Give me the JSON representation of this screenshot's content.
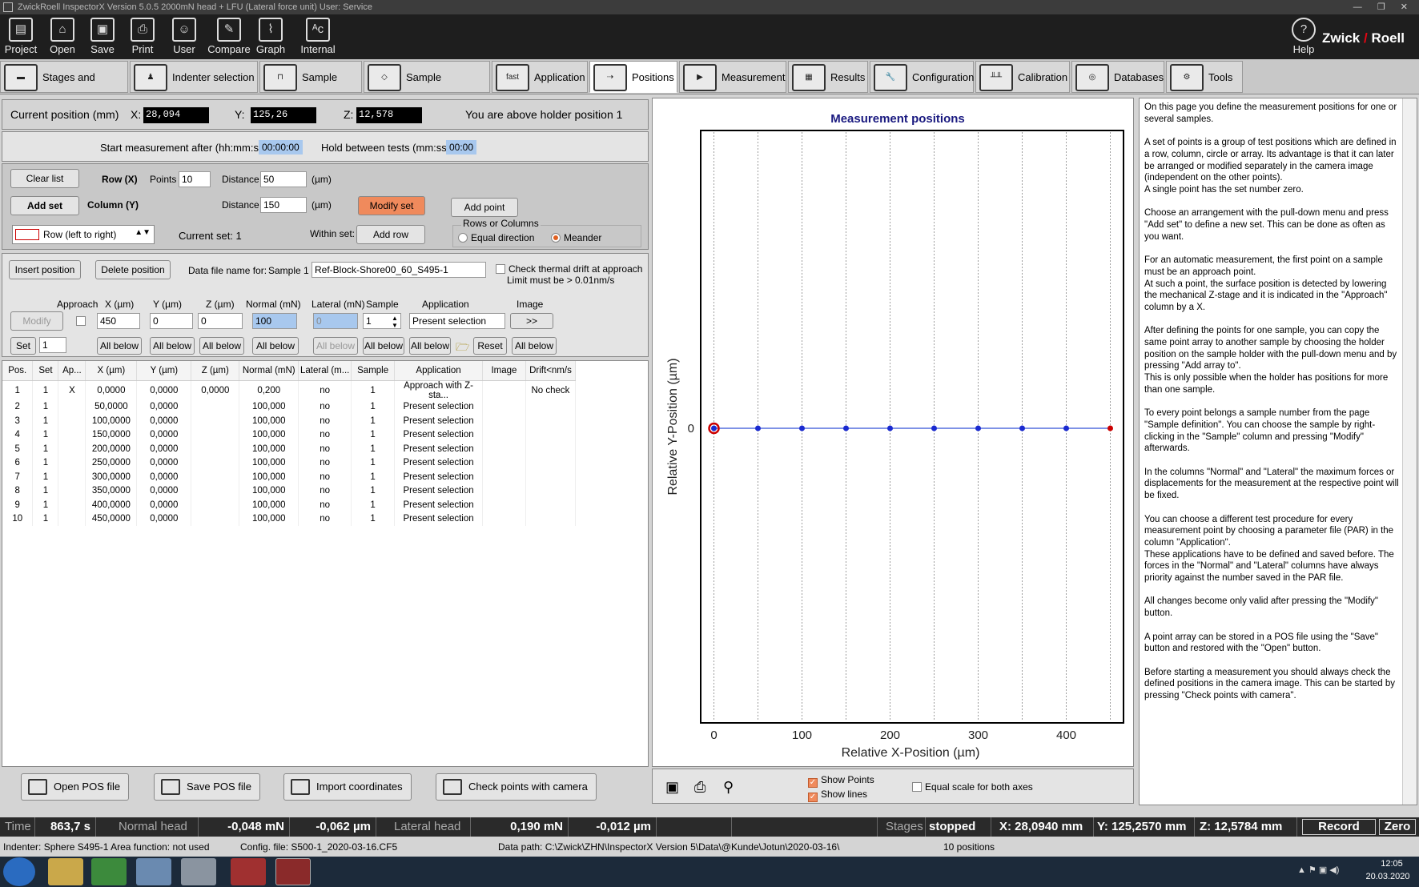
{
  "titlebar": {
    "text": "ZwickRoell   InspectorX  Version 5.0.5    2000mN head + LFU (Lateral force unit)    User: Service"
  },
  "toolbar": {
    "items": [
      "Project",
      "Open",
      "Save",
      "Print",
      "User",
      "Compare",
      "Graph",
      "Internal"
    ],
    "help": "Help",
    "logo_left": "Zwick",
    "logo_right": "Roell"
  },
  "tabs": [
    "Stages and Optics",
    "Indenter selection",
    "Sample fixing",
    "Sample properties",
    "Application",
    "Positions",
    "Measurement",
    "Results",
    "Configuration",
    "Calibration",
    "Databases",
    "Tools"
  ],
  "active_tab": "Positions",
  "position": {
    "label": "Current position (mm)",
    "x_label": "X:",
    "x": "28,094",
    "y_label": "Y:",
    "y": "125,26",
    "z_label": "Z:",
    "z": "12,578",
    "holder_text": "You are above holder position 1"
  },
  "start": {
    "after_label": "Start measurement after (hh:mm:ss)",
    "after_value": "00:00:00",
    "hold_label": "Hold between tests (mm:ss)",
    "hold_value": "00:00"
  },
  "setpanel": {
    "clear_list": "Clear list",
    "row_label": "Row (X)",
    "points_label": "Points",
    "points_value": "10",
    "distance_label": "Distance",
    "distance_row_value": "50",
    "unit": "(µm)",
    "add_set": "Add set",
    "column_label": "Column (Y)",
    "distance_col_value": "150",
    "modify_set": "Modify set",
    "add_point": "Add point",
    "pattern": "Row (left to right)",
    "current_set": "Current set: 1",
    "within_set": "Within set:",
    "add_row": "Add row",
    "rows_or_columns": "Rows or Columns",
    "equal_direction": "Equal direction",
    "meander": "Meander"
  },
  "editpanel": {
    "insert_position": "Insert position",
    "delete_position": "Delete position",
    "data_file_label": "Data file name for:",
    "sample_label": "Sample 1",
    "data_file_value": "Ref-Block-Shore00_60_S495-1",
    "thermal_drift": "Check thermal drift at approach",
    "limit_text": "Limit must be > 0.01nm/s",
    "col_approach": "Approach",
    "col_x": "X (µm)",
    "col_y": "Y (µm)",
    "col_z": "Z (µm)",
    "col_normal": "Normal (mN)",
    "col_lateral": "Lateral (mN)",
    "col_sample": "Sample",
    "col_application": "Application",
    "col_image": "Image",
    "modify": "Modify",
    "x_value": "450",
    "y_value": "0",
    "z_value": "0",
    "normal_value": "100",
    "lateral_value": "0",
    "sample_value": "1",
    "application_value": "Present selection",
    "image_btn": ">>",
    "set_btn": "Set",
    "set_value": "1",
    "all_below": "All below",
    "reset": "Reset"
  },
  "table": {
    "headers": [
      "Pos.",
      "Set",
      "Ap...",
      "X (µm)",
      "Y (µm)",
      "Z (µm)",
      "Normal (mN)",
      "Lateral (m...",
      "Sample",
      "Application",
      "Image",
      "Drift<nm/s"
    ],
    "rows": [
      [
        "1",
        "1",
        "X",
        "0,0000",
        "0,0000",
        "0,0000",
        "0,200",
        "no",
        "1",
        "Approach with Z-sta...",
        "",
        "No check"
      ],
      [
        "2",
        "1",
        "",
        "50,0000",
        "0,0000",
        "",
        "100,000",
        "no",
        "1",
        "Present selection",
        "",
        ""
      ],
      [
        "3",
        "1",
        "",
        "100,0000",
        "0,0000",
        "",
        "100,000",
        "no",
        "1",
        "Present selection",
        "",
        ""
      ],
      [
        "4",
        "1",
        "",
        "150,0000",
        "0,0000",
        "",
        "100,000",
        "no",
        "1",
        "Present selection",
        "",
        ""
      ],
      [
        "5",
        "1",
        "",
        "200,0000",
        "0,0000",
        "",
        "100,000",
        "no",
        "1",
        "Present selection",
        "",
        ""
      ],
      [
        "6",
        "1",
        "",
        "250,0000",
        "0,0000",
        "",
        "100,000",
        "no",
        "1",
        "Present selection",
        "",
        ""
      ],
      [
        "7",
        "1",
        "",
        "300,0000",
        "0,0000",
        "",
        "100,000",
        "no",
        "1",
        "Present selection",
        "",
        ""
      ],
      [
        "8",
        "1",
        "",
        "350,0000",
        "0,0000",
        "",
        "100,000",
        "no",
        "1",
        "Present selection",
        "",
        ""
      ],
      [
        "9",
        "1",
        "",
        "400,0000",
        "0,0000",
        "",
        "100,000",
        "no",
        "1",
        "Present selection",
        "",
        ""
      ],
      [
        "10",
        "1",
        "",
        "450,0000",
        "0,0000",
        "",
        "100,000",
        "no",
        "1",
        "Present selection",
        "",
        ""
      ]
    ]
  },
  "bottom_buttons": {
    "open_pos": "Open POS file",
    "save_pos": "Save POS file",
    "import": "Import coordinates",
    "check_camera": "Check points with camera"
  },
  "chart_data": {
    "type": "scatter",
    "title": "Measurement positions",
    "xlabel": "Relative X-Position (µm)",
    "ylabel": "Relative Y-Position (µm)",
    "xlim": [
      -15,
      465
    ],
    "xticks": [
      0,
      100,
      200,
      300,
      400
    ],
    "yticks": [
      0
    ],
    "grid_x": [
      0,
      50,
      100,
      150,
      200,
      250,
      300,
      350,
      400,
      450
    ],
    "x": [
      0,
      50,
      100,
      150,
      200,
      250,
      300,
      350,
      400,
      450
    ],
    "y": [
      0,
      0,
      0,
      0,
      0,
      0,
      0,
      0,
      0,
      0
    ],
    "line_color": "#3050d8",
    "point_color": "#1a2ad0",
    "first_point_color": "#cc0000",
    "last_point_color": "#cc0000"
  },
  "chart_controls": {
    "show_points": "Show Points",
    "show_lines": "Show lines",
    "equal_scale": "Equal scale for both axes"
  },
  "help_paragraphs": [
    "On this page you define the measurement positions for one or several samples.",
    "A set of points is a group of test positions which are defined in a row, column, circle or array. Its advantage is that it can later be arranged or modified separately in the camera image (independent on the other points).\nA single point has the set number zero.",
    "Choose an arrangement with the pull-down menu and press \"Add set\" to define a new set. This can be done as often as you want.",
    "For an automatic measurement, the first point on a sample must be an approach point.\nAt such a point, the surface position is detected by lowering the mechanical Z-stage and it is indicated in the \"Approach\" column by a X.",
    "After defining the points for one sample, you can copy the same point array to another sample by choosing the holder position on the sample holder with the pull-down menu and by pressing \"Add array to\".\nThis is only possible when the holder has positions for more than one sample.",
    "To every point belongs a sample number from the page \"Sample definition\". You can choose the sample by right-clicking in the \"Sample\" column and pressing \"Modify\" afterwards.",
    "In the columns \"Normal\" and \"Lateral\" the maximum forces or displacements for the measurement at the respective point will be fixed.",
    "You can choose a different test procedure for every measurement point by choosing a parameter file (PAR) in the column \"Application\".\nThese applications have to be defined and saved before. The forces in the \"Normal\" and \"Lateral\" columns have always priority against the number saved in the PAR file.",
    "All changes become only valid after pressing the \"Modify\" button.",
    "A point array can be stored in a POS file using the \"Save\" button and restored with the \"Open\" button.",
    "Before starting a measurement you should always check the defined positions in the camera image. This can be started by pressing \"Check points with camera\"."
  ],
  "status": {
    "time_label": "Time",
    "time_value": "863,7 s",
    "normal_label": "Normal head",
    "normal_force": "-0,048 mN",
    "normal_disp": "-0,062 µm",
    "lateral_label": "Lateral head",
    "lateral_force": "0,190 mN",
    "lateral_disp": "-0,012 µm",
    "stages_label": "Stages",
    "stages_value": "stopped",
    "x": "X: 28,0940 mm",
    "y": "Y: 125,2570 mm",
    "z": "Z: 12,5784 mm",
    "record": "Record",
    "zero": "Zero"
  },
  "info": {
    "indenter": "Indenter: Sphere   S495-1   Area function: not used",
    "config": "Config. file:  S500-1_2020-03-16.CF5",
    "datapath": "Data path:  C:\\Zwick\\ZHN\\InspectorX Version 5\\Data\\@Kunde\\Jotun\\2020-03-16\\",
    "positions": "10 positions"
  },
  "taskbar": {
    "time": "12:05",
    "date": "20.03.2020"
  },
  "colors": {
    "orange": "#f08a5c",
    "blue_field": "#a8c8ee",
    "statusbar": "#2a2a2a"
  }
}
